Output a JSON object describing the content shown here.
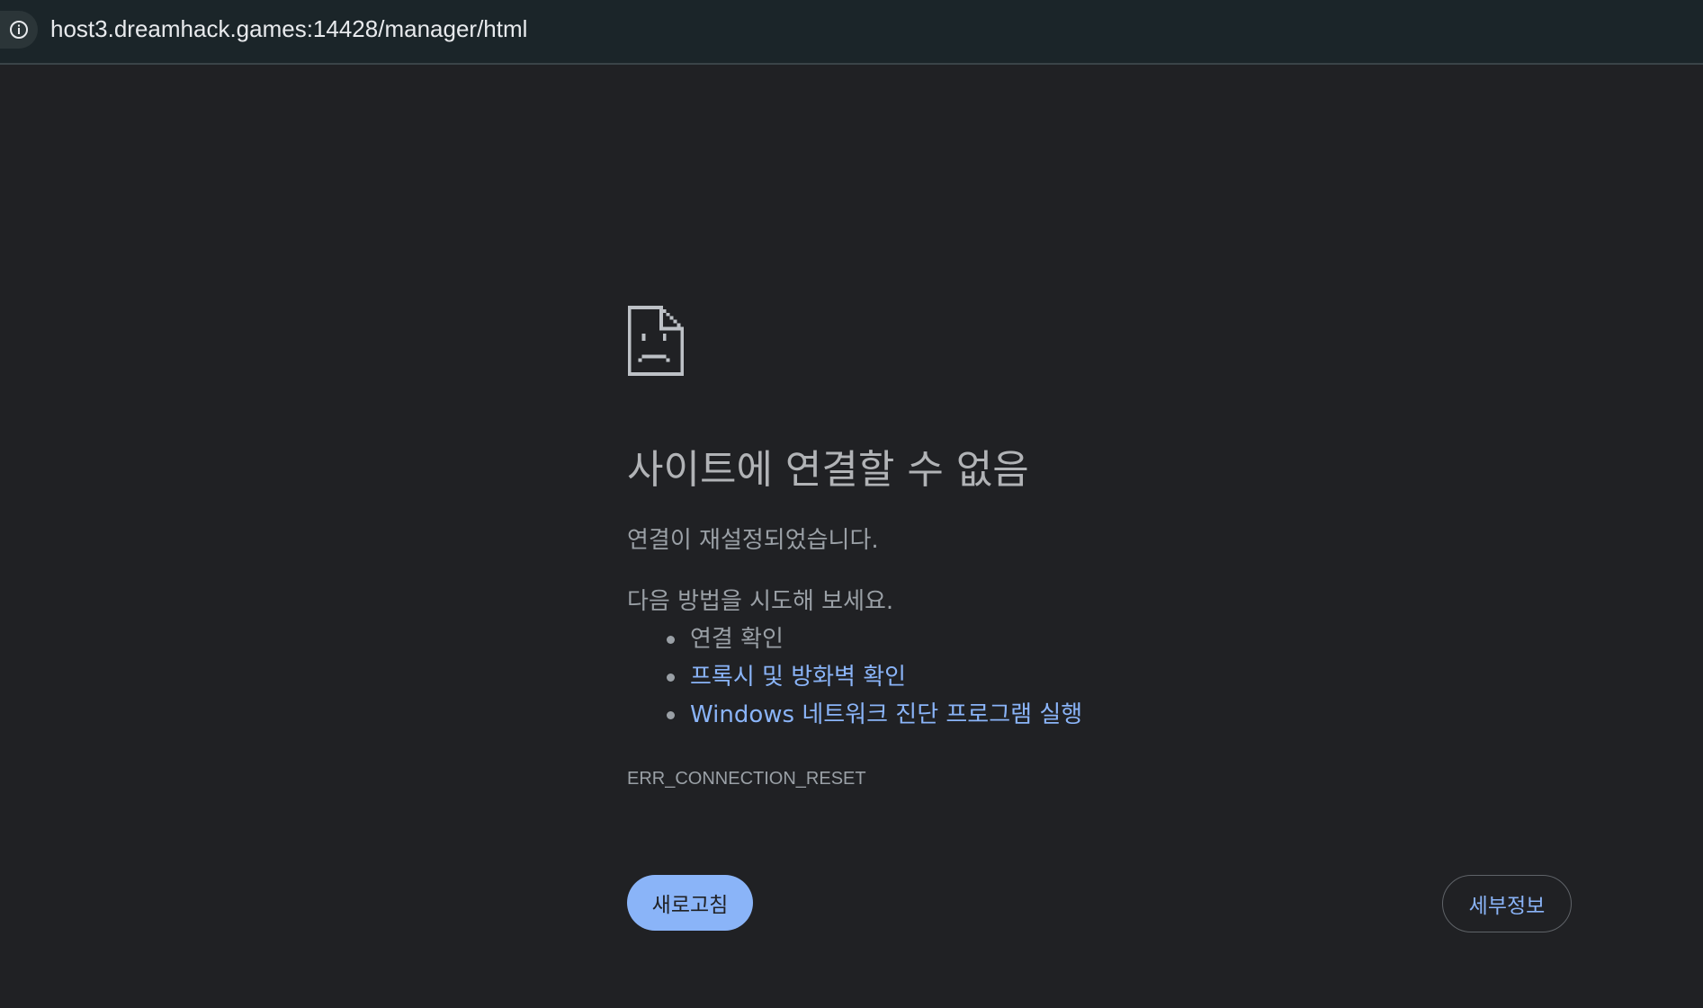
{
  "addressbar": {
    "url": "host3.dreamhack.games:14428/manager/html",
    "info_icon": "info-circle-icon"
  },
  "error": {
    "icon": "sad-document-icon",
    "title": "사이트에 연결할 수 없음",
    "subtitle": "연결이 재설정되었습니다.",
    "suggestions_heading": "다음 방법을 시도해 보세요.",
    "suggestions": [
      {
        "label": "연결 확인",
        "link": false
      },
      {
        "label": "프록시 및 방화벽 확인",
        "link": true
      },
      {
        "label": "Windows 네트워크 진단 프로그램 실행",
        "link": true
      }
    ],
    "code": "ERR_CONNECTION_RESET"
  },
  "buttons": {
    "reload_label": "새로고침",
    "details_label": "세부정보"
  },
  "colors": {
    "background": "#202124",
    "link": "#8ab4f8",
    "primary_button": "#8ab4f8",
    "text": "#9aa0a6"
  }
}
